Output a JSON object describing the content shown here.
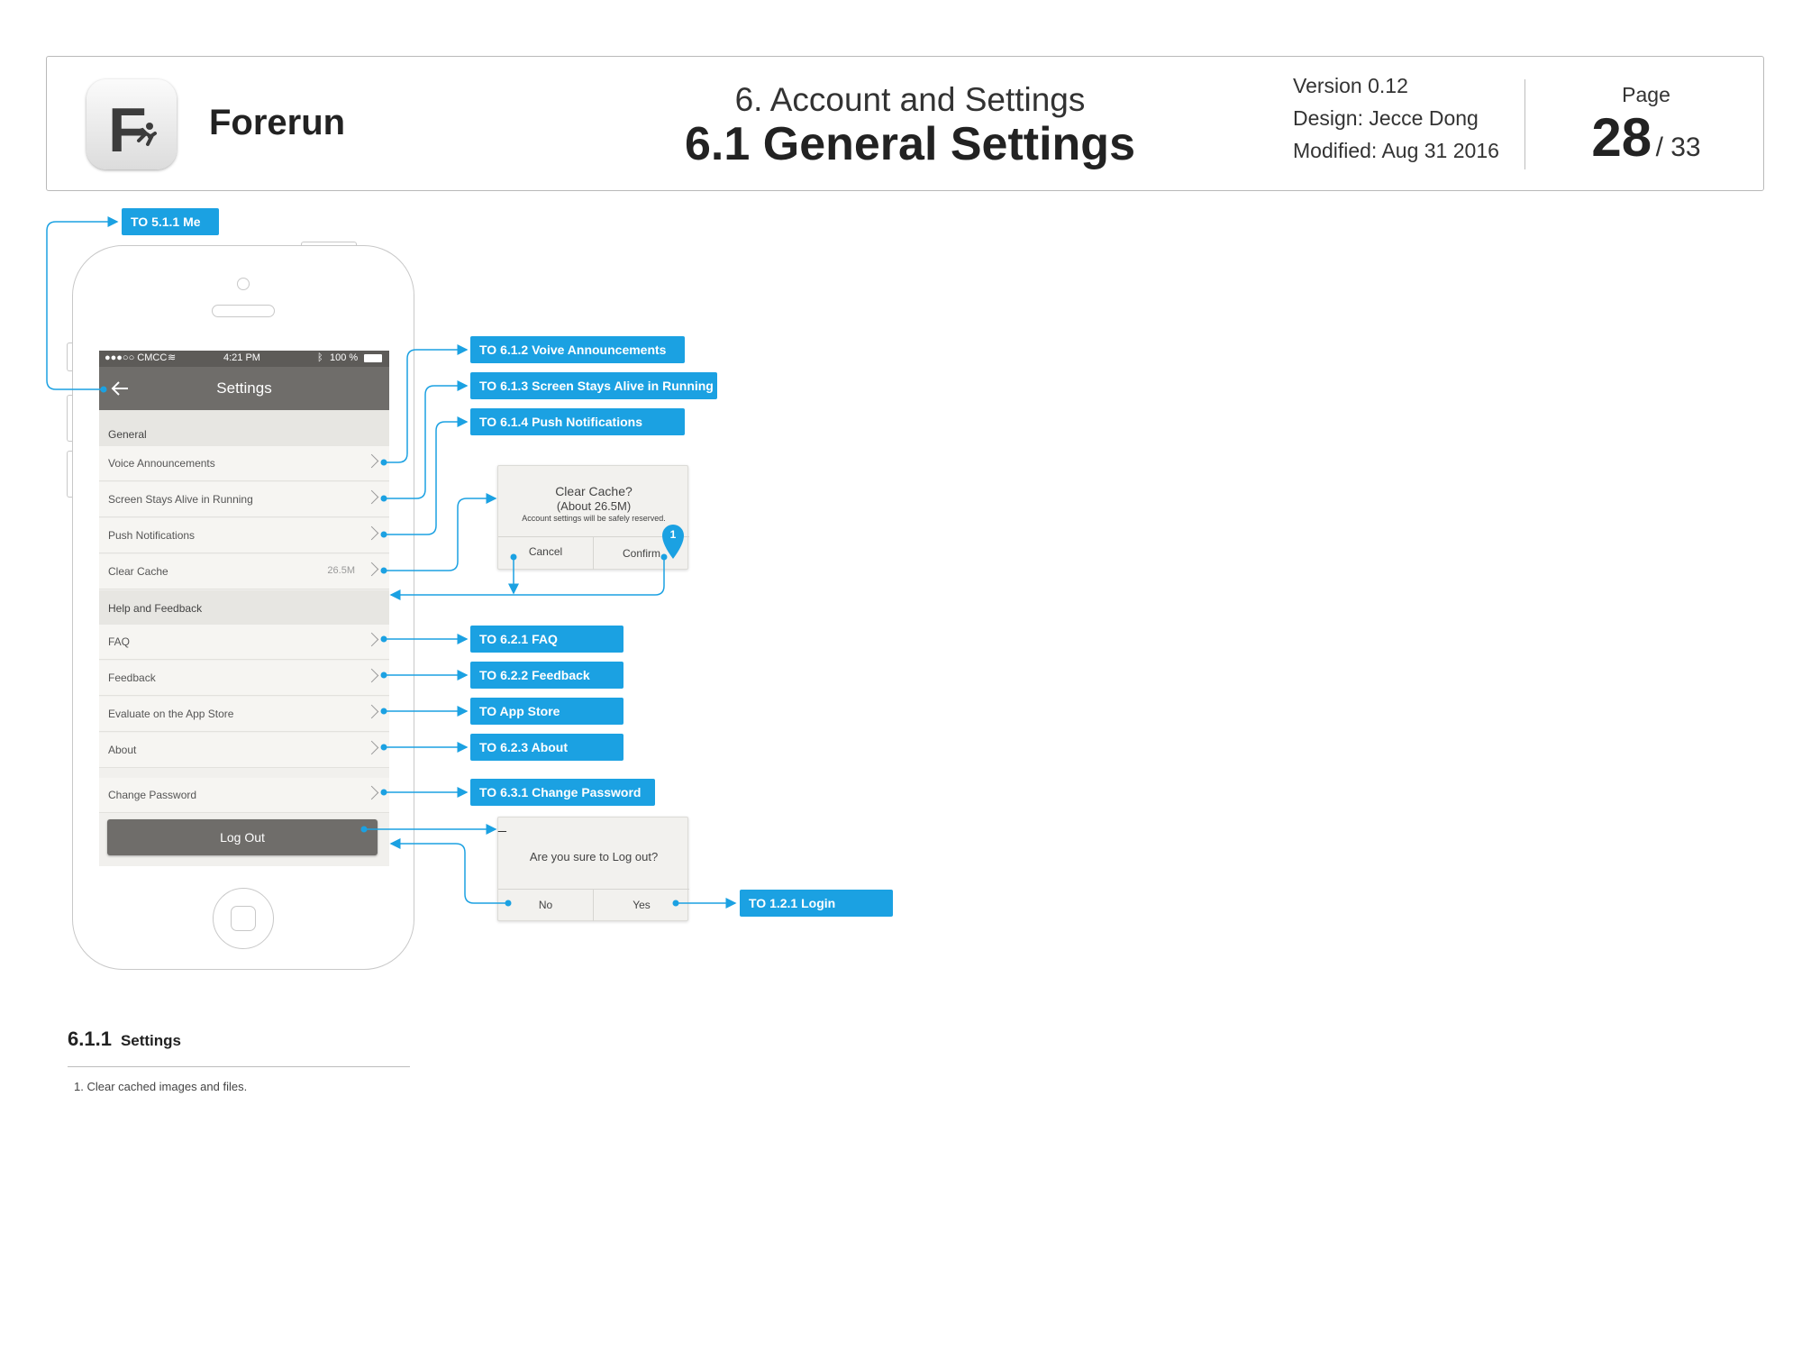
{
  "header": {
    "app_name": "Forerun",
    "logo_letter": "F",
    "section_title": "6. Account and Settings",
    "page_title": "6.1 General Settings",
    "version": "Version 0.12",
    "design": "Design: Jecce Dong",
    "modified": "Modified: Aug 31 2016",
    "page_label": "Page",
    "page_number": "28",
    "page_total": "/ 33"
  },
  "phone": {
    "status": {
      "carrier": "●●●○○ CMCC",
      "time": "4:21 PM",
      "battery": "100 %"
    },
    "nav_title": "Settings",
    "sections": {
      "general": "General",
      "help": "Help and Feedback"
    },
    "rows": {
      "voice": "Voice Announcements",
      "screen": "Screen Stays Alive in Running",
      "push": "Push Notifications",
      "cache": "Clear Cache",
      "cache_value": "26.5M",
      "faq": "FAQ",
      "feedback": "Feedback",
      "evaluate": "Evaluate on the App Store",
      "about": "About",
      "change_password": "Change Password"
    },
    "logout_label": "Log Out"
  },
  "dialogs": {
    "cache": {
      "title": "Clear Cache?",
      "size": "(About 26.5M)",
      "note": "Account settings will be safely reserved.",
      "cancel": "Cancel",
      "confirm": "Confirm",
      "marker": "1"
    },
    "logout": {
      "question": "Are you sure to Log out?",
      "no": "No",
      "yes": "Yes"
    }
  },
  "links": {
    "me": "TO 5.1.1 Me",
    "voice": "TO 6.1.2 Voive Announcements",
    "screen": "TO 6.1.3 Screen Stays Alive in Running",
    "push": "TO 6.1.4 Push Notifications",
    "faq": "TO 6.2.1 FAQ",
    "feedback": "TO 6.2.2 Feedback",
    "appstore": "TO App Store",
    "about": "TO 6.2.3 About",
    "change_password": "TO 6.3.1 Change Password",
    "login": "TO 1.2.1 Login"
  },
  "notes": {
    "number": "6.1.1",
    "title": "Settings",
    "items": [
      "1. Clear cached images and files."
    ]
  },
  "colors": {
    "accent": "#1ba1e2",
    "navbar": "#6f6d6a",
    "statusbar": "#5d5b58"
  }
}
